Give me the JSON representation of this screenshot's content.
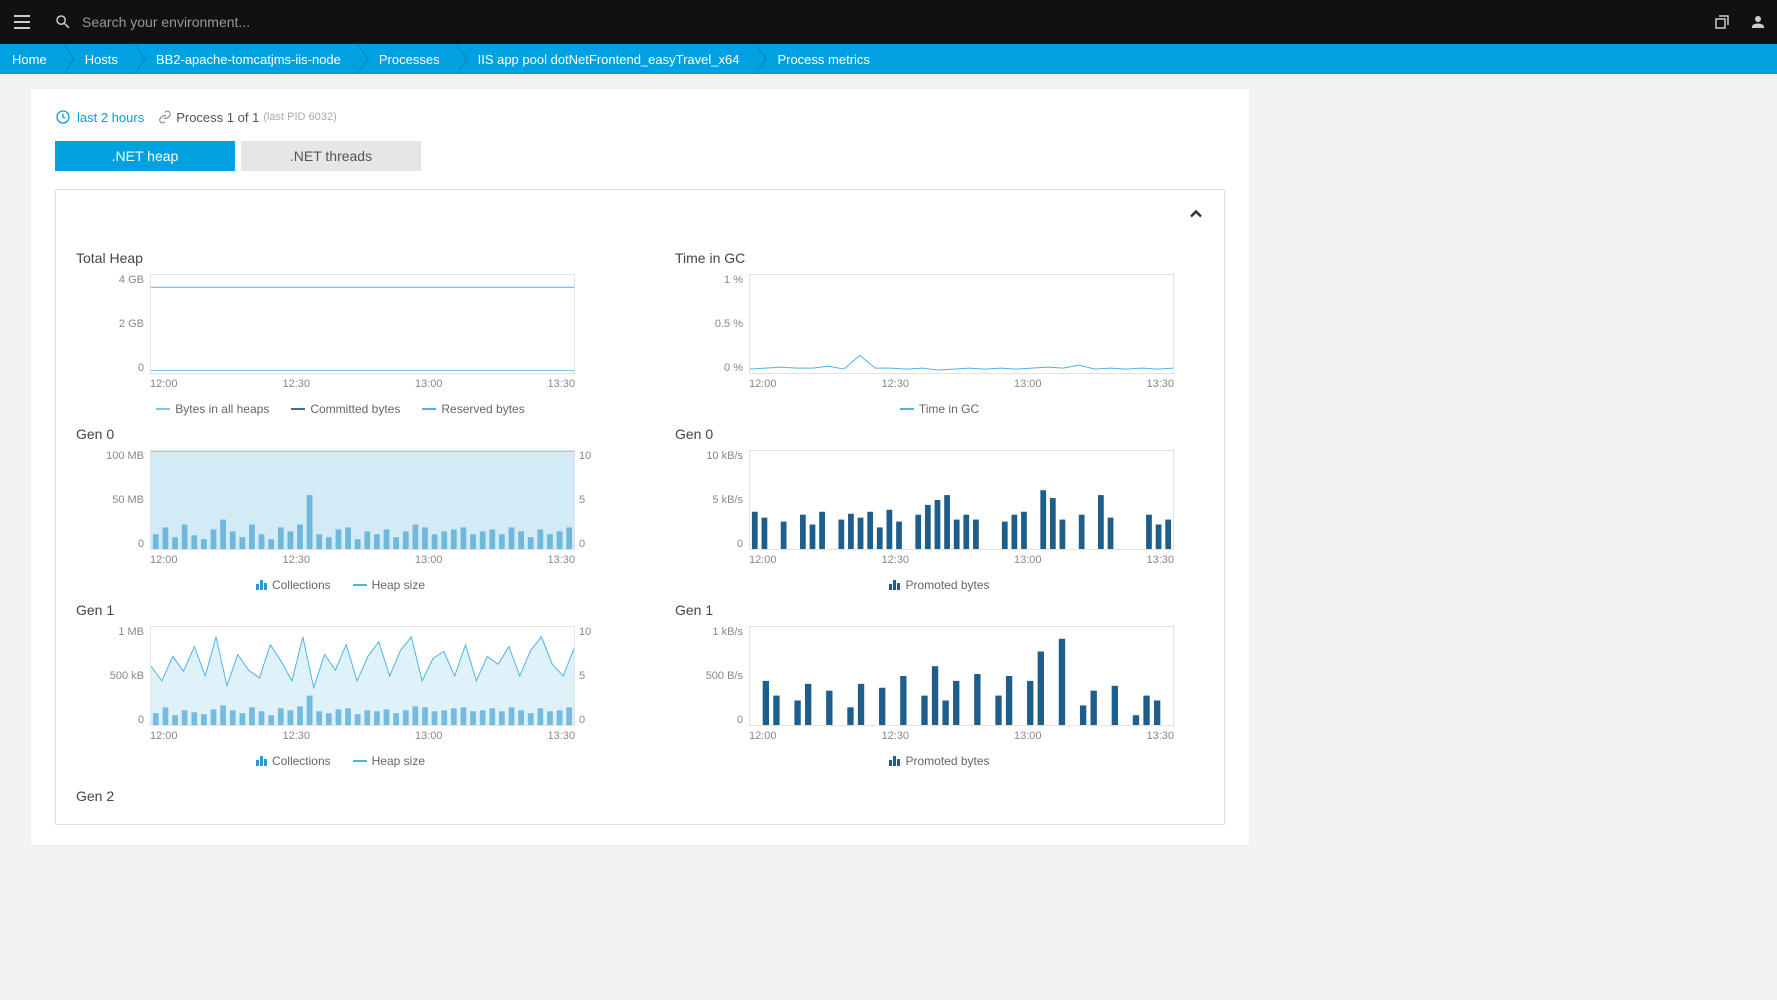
{
  "topbar": {
    "search_placeholder": "Search your environment..."
  },
  "breadcrumb": [
    "Home",
    "Hosts",
    "BB2-apache-tomcatjms-iis-node",
    "Processes",
    "IIS app pool dotNetFrontend_easyTravel_x64",
    "Process metrics"
  ],
  "meta": {
    "time_label": "last 2 hours",
    "process_info": "Process 1 of 1",
    "pid_info": "(last PID 6032)"
  },
  "tabs": {
    "heap": ".NET heap",
    "threads": ".NET threads"
  },
  "xticks": [
    "12:00",
    "12:30",
    "13:00",
    "13:30"
  ],
  "charts": {
    "total_heap": {
      "title": "Total Heap",
      "yticks": [
        "4 GB",
        "2 GB",
        "0"
      ],
      "legend": [
        "Bytes in all heaps",
        "Committed bytes",
        "Reserved bytes"
      ]
    },
    "time_gc": {
      "title": "Time in GC",
      "yticks": [
        "1 %",
        "0.5 %",
        "0 %"
      ],
      "legend": [
        "Time in GC"
      ]
    },
    "gen0_left": {
      "title": "Gen 0",
      "yticks": [
        "100 MB",
        "50 MB",
        "0"
      ],
      "yticks2": [
        "10",
        "5",
        "0"
      ],
      "legend": [
        "Collections",
        "Heap size"
      ]
    },
    "gen0_right": {
      "title": "Gen 0",
      "yticks": [
        "10 kB/s",
        "5 kB/s",
        "0"
      ],
      "legend": [
        "Promoted bytes"
      ]
    },
    "gen1_left": {
      "title": "Gen 1",
      "yticks": [
        "1 MB",
        "500 kB",
        "0"
      ],
      "yticks2": [
        "10",
        "5",
        "0"
      ],
      "legend": [
        "Collections",
        "Heap size"
      ]
    },
    "gen1_right": {
      "title": "Gen 1",
      "yticks": [
        "1 kB/s",
        "500 B/s",
        "0"
      ],
      "legend": [
        "Promoted bytes"
      ]
    },
    "gen2": {
      "title": "Gen 2"
    }
  },
  "chart_data": [
    {
      "type": "line",
      "title": "Total Heap",
      "xlabel": "",
      "ylabel": "",
      "x": [
        "12:00",
        "12:30",
        "13:00",
        "13:30"
      ],
      "ylim": [
        0,
        4
      ],
      "series": [
        {
          "name": "Bytes in all heaps",
          "values": [
            0.1,
            0.1,
            0.1,
            0.1
          ]
        },
        {
          "name": "Committed bytes",
          "values": [
            0.1,
            0.1,
            0.1,
            0.1
          ]
        },
        {
          "name": "Reserved bytes",
          "values": [
            3.5,
            3.5,
            3.5,
            3.5
          ]
        }
      ]
    },
    {
      "type": "line",
      "title": "Time in GC",
      "xlabel": "",
      "ylabel": "%",
      "x": [
        "12:00",
        "12:30",
        "13:00",
        "13:30"
      ],
      "ylim": [
        0,
        1
      ],
      "series": [
        {
          "name": "Time in GC",
          "values": [
            0.04,
            0.05,
            0.06,
            0.05,
            0.05,
            0.07,
            0.04,
            0.18,
            0.05,
            0.05,
            0.04,
            0.05,
            0.03,
            0.04,
            0.05,
            0.04,
            0.05,
            0.04,
            0.05,
            0.06,
            0.05,
            0.08,
            0.04,
            0.05,
            0.04,
            0.05,
            0.04,
            0.05
          ]
        }
      ]
    },
    {
      "type": "bar",
      "title": "Gen 0 – Collections / Heap size",
      "xlabel": "",
      "ylabel": "MB",
      "categories": [
        "12:00",
        "12:30",
        "13:00",
        "13:30"
      ],
      "ylim": [
        0,
        100
      ],
      "series": [
        {
          "name": "Collections",
          "values": [
            15,
            22,
            12,
            25,
            14,
            10,
            20,
            30,
            18,
            12,
            25,
            15,
            10,
            22,
            18,
            25,
            55,
            15,
            12,
            20,
            22,
            10,
            18,
            15,
            20,
            12,
            18,
            25,
            22,
            15,
            18,
            20,
            22,
            15,
            18,
            20,
            15,
            22,
            18,
            12,
            20,
            15,
            18,
            22
          ]
        },
        {
          "name": "Heap size",
          "values": [
            100
          ]
        }
      ]
    },
    {
      "type": "bar",
      "title": "Gen 0 – Promoted bytes",
      "xlabel": "",
      "ylabel": "kB/s",
      "ylim": [
        0,
        10
      ],
      "categories": [
        "12:00",
        "12:30",
        "13:00",
        "13:30"
      ],
      "series": [
        {
          "name": "Promoted bytes",
          "values": [
            3.8,
            3.2,
            0,
            2.8,
            0,
            3.5,
            2.5,
            3.8,
            0,
            3.0,
            3.6,
            3.2,
            3.8,
            2.2,
            4.0,
            2.8,
            0,
            3.5,
            4.5,
            5.0,
            5.5,
            3.0,
            3.5,
            3.0,
            0,
            0,
            2.8,
            3.5,
            3.8,
            0,
            6.0,
            5.2,
            3.0,
            0,
            3.5,
            0,
            5.5,
            3.2,
            0,
            0,
            0,
            3.5,
            2.5,
            3.0
          ]
        }
      ]
    },
    {
      "type": "bar",
      "title": "Gen 1 – Collections / Heap size",
      "xlabel": "",
      "ylabel": "kB",
      "ylim": [
        0,
        1000
      ],
      "categories": [
        "12:00",
        "12:30",
        "13:00",
        "13:30"
      ],
      "series": [
        {
          "name": "Collections",
          "values": [
            120,
            180,
            100,
            150,
            130,
            110,
            160,
            200,
            150,
            120,
            180,
            140,
            100,
            170,
            150,
            190,
            300,
            140,
            120,
            160,
            170,
            110,
            150,
            140,
            160,
            120,
            150,
            190,
            180,
            140,
            150,
            170,
            180,
            140,
            150,
            170,
            140,
            180,
            150,
            120,
            170,
            140,
            150,
            180
          ]
        },
        {
          "name": "Heap size",
          "values": [
            600,
            450,
            700,
            550,
            800,
            500,
            900,
            400,
            720,
            560,
            480,
            820,
            650,
            450,
            900,
            380,
            720,
            560,
            820,
            450,
            700,
            850,
            500,
            760,
            900,
            450,
            680,
            750,
            500,
            820,
            450,
            700,
            620,
            800,
            500,
            760,
            900,
            620,
            500,
            780
          ]
        }
      ]
    },
    {
      "type": "bar",
      "title": "Gen 1 – Promoted bytes",
      "xlabel": "",
      "ylabel": "B/s",
      "ylim": [
        0,
        1000
      ],
      "categories": [
        "12:00",
        "12:30",
        "13:00",
        "13:30"
      ],
      "series": [
        {
          "name": "Promoted bytes",
          "values": [
            0,
            450,
            300,
            0,
            250,
            420,
            0,
            350,
            0,
            180,
            420,
            0,
            380,
            0,
            500,
            0,
            300,
            600,
            250,
            450,
            0,
            520,
            0,
            300,
            500,
            0,
            450,
            750,
            0,
            880,
            0,
            200,
            350,
            0,
            400,
            0,
            100,
            300,
            250,
            0
          ]
        }
      ]
    }
  ]
}
